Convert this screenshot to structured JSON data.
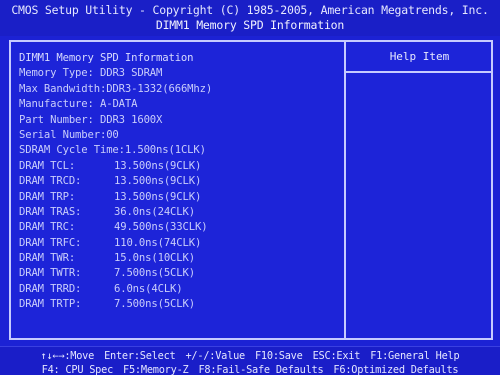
{
  "header": {
    "title": "CMOS Setup Utility - Copyright (C) 1985-2005, American Megatrends, Inc.",
    "subtitle": "DIMM1 Memory SPD Information"
  },
  "panel": {
    "heading": "DIMM1 Memory SPD Information",
    "info": [
      {
        "label": "Memory Type:",
        "value": "DDR3 SDRAM"
      },
      {
        "label": "Max Bandwidth:",
        "value": "DDR3-1332(666Mhz)"
      },
      {
        "label": "Manufacture:",
        "value": "A-DATA"
      },
      {
        "label": "Part Number:",
        "value": "DDR3 1600X"
      },
      {
        "label": "Serial Number:",
        "value": "00"
      },
      {
        "label": "SDRAM Cycle Time:",
        "value": "1.500ns(1CLK)"
      }
    ],
    "timings": [
      {
        "label": "DRAM TCL:",
        "value": "13.500ns(9CLK)"
      },
      {
        "label": "DRAM TRCD:",
        "value": "13.500ns(9CLK)"
      },
      {
        "label": "DRAM TRP:",
        "value": "13.500ns(9CLK)"
      },
      {
        "label": "DRAM TRAS:",
        "value": "36.0ns(24CLK)"
      },
      {
        "label": "DRAM TRC:",
        "value": "49.500ns(33CLK)"
      },
      {
        "label": "DRAM TRFC:",
        "value": "110.0ns(74CLK)"
      },
      {
        "label": "DRAM TWR:",
        "value": "15.0ns(10CLK)"
      },
      {
        "label": "DRAM TWTR:",
        "value": "7.500ns(5CLK)"
      },
      {
        "label": "DRAM TRRD:",
        "value": "6.0ns(4CLK)"
      },
      {
        "label": "DRAM TRTP:",
        "value": "7.500ns(5CLK)"
      }
    ]
  },
  "help": {
    "title": "Help Item"
  },
  "footer": {
    "line1": [
      "↑↓←→:Move",
      "Enter:Select",
      "+/-/:Value",
      "F10:Save",
      "ESC:Exit",
      "F1:General Help"
    ],
    "line2": [
      "F4: CPU Spec",
      "F5:Memory-Z",
      "F8:Fail-Safe Defaults",
      "F6:Optimized Defaults"
    ]
  },
  "colors": {
    "background": "#1c22d4",
    "text": "#c9cdfb",
    "border": "#c6cbff"
  }
}
